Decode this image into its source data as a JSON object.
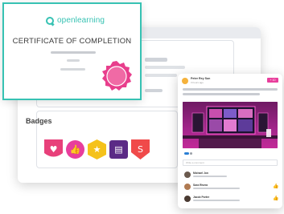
{
  "certificate": {
    "logo_text": "openlearning",
    "title": "CERTIFICATE OF COMPLETION",
    "accent_color": "#37c2b3",
    "seal_color": "#e83e8c"
  },
  "profile": {
    "badges_title": "Badges",
    "badges": [
      {
        "icon": "heart-icon",
        "glyph": "♥",
        "color": "#e8407a"
      },
      {
        "icon": "thumbs-up-icon",
        "glyph": "👍",
        "color": "#e83e9c"
      },
      {
        "icon": "star-icon",
        "glyph": "★",
        "color": "#f5c21b"
      },
      {
        "icon": "book-icon",
        "glyph": "▤",
        "color": "#5b2a86"
      },
      {
        "icon": "superhero-icon",
        "glyph": "S",
        "color": "#f04a4a"
      }
    ]
  },
  "post": {
    "author": "Peter Rey Sun",
    "time": "3 hours ago",
    "follow_label": "+ 10",
    "comment_placeholder": "Write a comment",
    "comments": [
      {
        "name": "Michael Jon",
        "avatar_color": "#6b5a4e"
      },
      {
        "name": "Sara Rivera",
        "avatar_color": "#b07a52"
      },
      {
        "name": "Jacob Porter",
        "avatar_color": "#4a3a32"
      }
    ],
    "accent_color": "#e83e9c"
  }
}
